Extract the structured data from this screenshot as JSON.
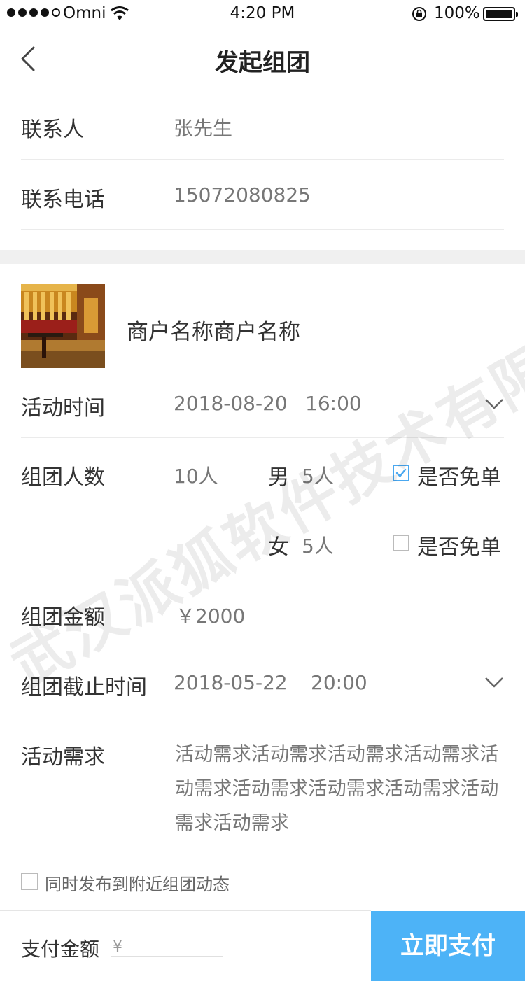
{
  "status_bar": {
    "carrier": "Omni",
    "time": "4:20 PM",
    "battery": "100%"
  },
  "nav": {
    "title": "发起组团",
    "back_icon": "chevron-left-icon"
  },
  "contact": {
    "name_label": "联系人",
    "name_value": "张先生",
    "phone_label": "联系电话",
    "phone_value": "15072080825"
  },
  "merchant": {
    "name": "商户名称商户名称"
  },
  "activity_time": {
    "label": "活动时间",
    "date": "2018-08-20",
    "time": "16:00"
  },
  "group_size": {
    "label": "组团人数",
    "total": "10人",
    "male_label": "男",
    "male_count": "5人",
    "male_free_label": "是否免单",
    "male_free_checked": true,
    "female_label": "女",
    "female_count": "5人",
    "female_free_label": "是否免单",
    "female_free_checked": false
  },
  "amount": {
    "label": "组团金额",
    "value": "￥2000"
  },
  "deadline": {
    "label": "组团截止时间",
    "date": "2018-05-22",
    "time": "20:00"
  },
  "requirement": {
    "label": "活动需求",
    "text": "活动需求活动需求活动需求活动需求活动需求活动需求活动需求活动需求活动需求活动需求"
  },
  "publish": {
    "label": "同时发布到附近组团动态",
    "checked": false
  },
  "footer": {
    "pay_label": "支付金额",
    "currency": "¥",
    "pay_button": "立即支付"
  },
  "watermark": "武汉派狐软件技术有限公司",
  "colors": {
    "accent": "#4db3f7",
    "check": "#4aa8f0"
  }
}
